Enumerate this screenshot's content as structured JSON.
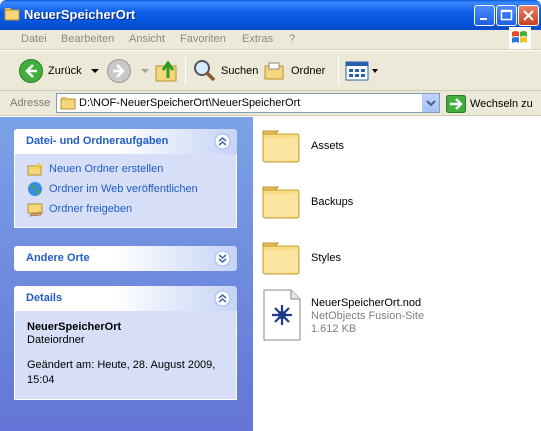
{
  "window": {
    "title": "NeuerSpeicherOrt"
  },
  "menu": [
    "Datei",
    "Bearbeiten",
    "Ansicht",
    "Favoriten",
    "Extras",
    "?"
  ],
  "toolbar": {
    "back": "Zurück",
    "search": "Suchen",
    "folders": "Ordner"
  },
  "address": {
    "label": "Adresse",
    "path": "D:\\NOF-NeuerSpeicherOrt\\NeuerSpeicherOrt",
    "go": "Wechseln zu"
  },
  "tasks": {
    "title": "Datei- und Ordneraufgaben",
    "items": [
      {
        "label": "Neuen Ordner erstellen",
        "icon": "new-folder-icon"
      },
      {
        "label": "Ordner im Web veröffentlichen",
        "icon": "globe-icon"
      },
      {
        "label": "Ordner freigeben",
        "icon": "share-folder-icon"
      }
    ]
  },
  "other_places": {
    "title": "Andere Orte"
  },
  "details": {
    "title": "Details",
    "name": "NeuerSpeicherOrt",
    "type": "Dateiordner",
    "modified_line1": "Geändert am: Heute, 28. August 2009,",
    "modified_line2": "15:04"
  },
  "files": [
    {
      "name": "Assets",
      "kind": "folder"
    },
    {
      "name": "Backups",
      "kind": "folder"
    },
    {
      "name": "Styles",
      "kind": "folder"
    },
    {
      "name": "NeuerSpeicherOrt.nod",
      "kind": "file",
      "type": "NetObjects Fusion-Site",
      "size": "1.612 KB"
    }
  ],
  "colors": {
    "titlebar": "#0656e0",
    "taskpane": "#6375d6",
    "link": "#215dc6",
    "folder": "#f5d77a"
  }
}
